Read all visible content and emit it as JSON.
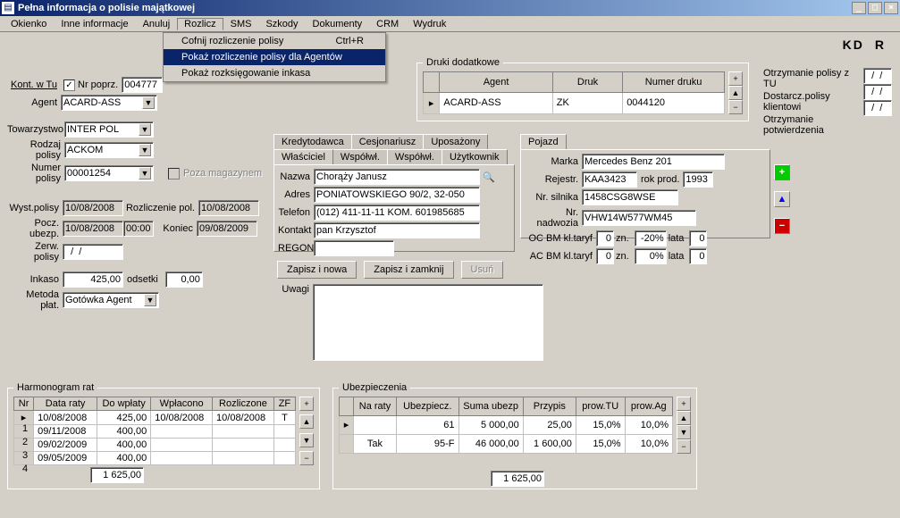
{
  "window": {
    "title": "Pełna informacja o polisie majątkowej"
  },
  "menu": {
    "items": [
      "Okienko",
      "Inne informacje",
      "Anuluj",
      "Rozlicz",
      "SMS",
      "Szkody",
      "Dokumenty",
      "CRM",
      "Wydruk"
    ],
    "open_index": 3,
    "dropdown": [
      {
        "label": "Cofnij rozliczenie polisy",
        "accel": "Ctrl+R",
        "hl": false
      },
      {
        "label": "Pokaż rozliczenie polisy dla Agentów",
        "accel": "",
        "hl": true
      },
      {
        "label": "Pokaż rozksięgowanie inkasa",
        "accel": "",
        "hl": false
      }
    ]
  },
  "kd_r": {
    "k": "KD",
    "r": "R"
  },
  "left": {
    "kont_w_tu": "Kont. w Tu",
    "nr_poprz_label": "Nr poprz.",
    "nr_poprz_checked": true,
    "nr_poprz_value": "004777",
    "agent_label": "Agent",
    "agent_value": "ACARD-ASS",
    "towarzystwo_label": "Towarzystwo",
    "towarzystwo_value": "INTER POL",
    "rodzaj_label": "Rodzaj polisy",
    "rodzaj_value": "ACKOM",
    "numer_label": "Numer polisy",
    "numer_value": "00001254",
    "poza_magazynem": "Poza magazynem",
    "wyst_label": "Wyst.polisy",
    "wyst_value": "10/08/2008",
    "rozliczenie_label": "Rozliczenie pol.",
    "rozliczenie_value": "10/08/2008",
    "pocz_label": "Pocz. ubezp.",
    "pocz_value": "10/08/2008",
    "pocz_time": "00:00",
    "koniec_label": "Koniec",
    "koniec_value": "09/08/2009",
    "zerw_label": "Zerw. polisy",
    "zerw_value": "  /  /",
    "inkaso_label": "Inkaso",
    "inkaso_value": "425,00",
    "odsetki_label": "odsetki",
    "odsetki_value": "0,00",
    "metoda_label": "Metoda płat.",
    "metoda_value": "Gotówka Agent"
  },
  "druki": {
    "legend": "Druki dodatkowe",
    "headers": [
      "Agent",
      "Druk",
      "Numer druku"
    ],
    "row": [
      "ACARD-ASS",
      "ZK",
      "0044120"
    ]
  },
  "delivery": {
    "rows": [
      {
        "label": "Otrzymanie polisy z TU",
        "val": "  /  /"
      },
      {
        "label": "Dostarcz.polisy klientowi",
        "val": "  /  /"
      },
      {
        "label": "Otrzymanie potwierdzenia",
        "val": "  /  /"
      }
    ]
  },
  "party_tabs": {
    "upper": [
      "Kredytodawca",
      "Cesjonariusz",
      "Uposażony"
    ],
    "lower": [
      "Właściciel",
      "Współwł.",
      "Współwł.",
      "Użytkownik"
    ],
    "nazwa_label": "Nazwa",
    "nazwa": "Chorąży Janusz",
    "adres_label": "Adres",
    "adres": "PONIATOWSKIEGO 90/2, 32-050",
    "telefon_label": "Telefon",
    "telefon": "(012) 411-11-11 KOM. 601985685",
    "kontakt_label": "Kontakt",
    "kontakt": "pan Krzysztof",
    "regon_label": "REGON",
    "regon": ""
  },
  "pojazd": {
    "tab": "Pojazd",
    "marka_label": "Marka",
    "marka": "Mercedes Benz 201",
    "rejestr_label": "Rejestr.",
    "rejestr": "KAA3423",
    "rok_label": "rok prod.",
    "rok": "1993",
    "silnik_label": "Nr. silnika",
    "silnik": "1458CSG8WSE",
    "nadwozie_label": "Nr. nadwozia",
    "nadwozie": "VHW14W577WM45",
    "ocbm_label": "OC BM  kl.taryf",
    "oc_kl": "0",
    "zn_label": "zn.",
    "oc_zn": "-20%",
    "lata_label": "lata",
    "oc_lata": "0",
    "acbm_label": "AC BM  kl.taryf",
    "ac_kl": "0",
    "ac_zn": "0%",
    "ac_lata": "0"
  },
  "buttons": {
    "zapisz_nowa": "Zapisz i nowa",
    "zapisz_zamknij": "Zapisz i zamknij",
    "usun": "Usuń"
  },
  "uwagi_label": "Uwagi",
  "harmonogram": {
    "legend": "Harmonogram rat",
    "headers": [
      "Nr",
      "Data raty",
      "Do wpłaty",
      "Wpłacono",
      "Rozliczone",
      "ZF"
    ],
    "rows": [
      [
        "1",
        "10/08/2008",
        "425,00",
        "10/08/2008",
        "10/08/2008",
        "T"
      ],
      [
        "2",
        "09/11/2008",
        "400,00",
        "",
        "",
        ""
      ],
      [
        "3",
        "09/02/2009",
        "400,00",
        "",
        "",
        ""
      ],
      [
        "4",
        "09/05/2009",
        "400,00",
        "",
        "",
        ""
      ]
    ],
    "total": "1 625,00"
  },
  "ubezpieczenia": {
    "legend": "Ubezpieczenia",
    "headers": [
      "Na raty",
      "Ubezpiecz.",
      "Suma ubezp",
      "Przypis",
      "prow.TU",
      "prow.Ag"
    ],
    "rows": [
      [
        "",
        "61",
        "5 000,00",
        "25,00",
        "15,0%",
        "10,0%"
      ],
      [
        "Tak",
        "95-F",
        "46 000,00",
        "1 600,00",
        "15,0%",
        "10,0%"
      ]
    ],
    "total": "1 625,00"
  }
}
